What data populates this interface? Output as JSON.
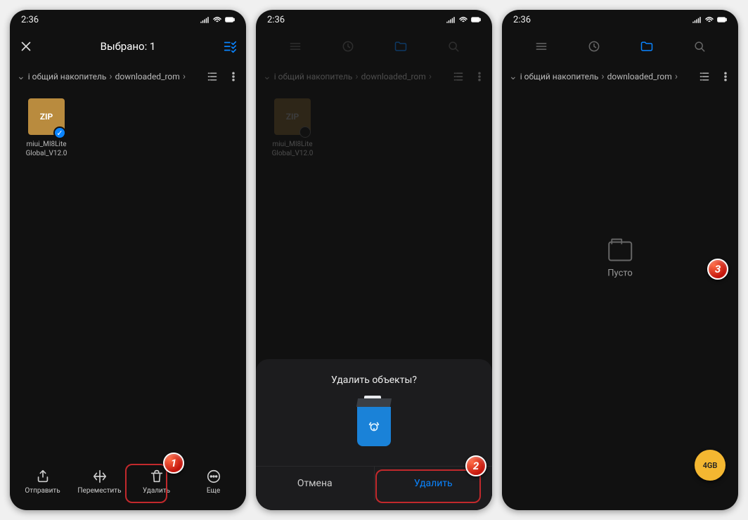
{
  "statusbar": {
    "time": "2:36"
  },
  "phone1": {
    "title": "Выбрано: 1",
    "breadcrumb": {
      "seg1": "i общий накопитель",
      "seg2": "downloaded_rom"
    },
    "file": {
      "badge": "ZIP",
      "name_l1": "miui_MI8Lite",
      "name_l2": "Global_V12.0"
    },
    "actions": {
      "send": "Отправить",
      "move": "Переместить",
      "delete": "Удалить",
      "more": "Еще"
    },
    "step": "1"
  },
  "phone2": {
    "breadcrumb": {
      "seg1": "i общий накопитель",
      "seg2": "downloaded_rom"
    },
    "file": {
      "badge": "ZIP",
      "name_l1": "miui_MI8Lite",
      "name_l2": "Global_V12.0"
    },
    "sheet": {
      "title": "Удалить объекты?",
      "cancel": "Отмена",
      "confirm": "Удалить"
    },
    "step": "2"
  },
  "phone3": {
    "breadcrumb": {
      "seg1": "i общий накопитель",
      "seg2": "downloaded_rom"
    },
    "empty": "Пусто",
    "fab": "4GB",
    "step": "3"
  }
}
